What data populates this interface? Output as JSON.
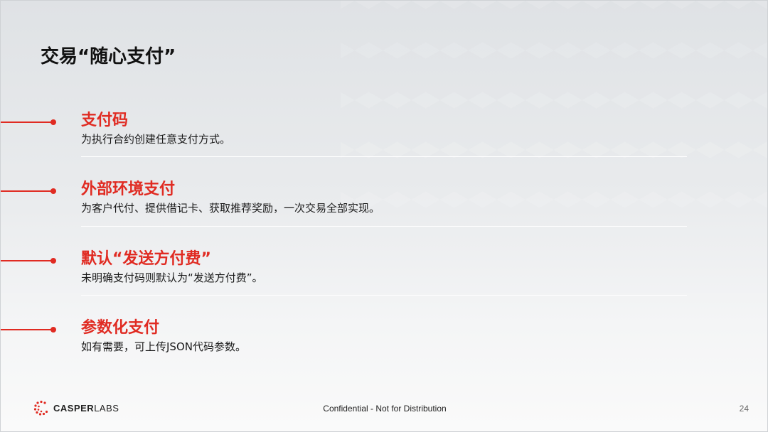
{
  "title": "交易“随心支付”",
  "items": [
    {
      "heading": "支付码",
      "desc": "为执行合约创建任意支付方式。"
    },
    {
      "heading": "外部环境支付",
      "desc": "为客户代付、提供借记卡、获取推荐奖励，一次交易全部实现。"
    },
    {
      "heading": "默认“发送方付费”",
      "desc": "未明确支付码则默认为“发送方付费”。"
    },
    {
      "heading": "参数化支付",
      "desc": "如有需要，可上传JSON代码参数。"
    }
  ],
  "footer": {
    "brand_bold": "CASPER",
    "brand_light": "LABS",
    "center": "Confidential - Not for Distribution",
    "page": "24"
  },
  "colors": {
    "accent": "#e02b22"
  }
}
